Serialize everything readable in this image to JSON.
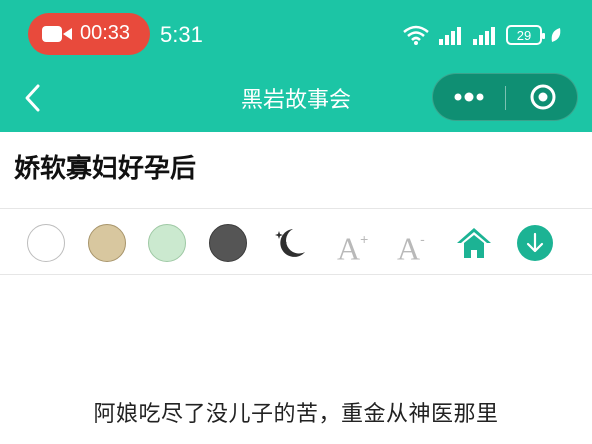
{
  "status_bar": {
    "record_time": "00:33",
    "clock": "5:31",
    "battery": "29",
    "colors": {
      "background": "#1cc5a5",
      "record_pill": "#e84a3c"
    }
  },
  "nav": {
    "title": "黑岩故事会",
    "icons": {
      "back": "chevron-left-icon",
      "more": "more-dots-icon",
      "close": "target-circle-icon"
    }
  },
  "article": {
    "title": "娇软寡妇好孕后",
    "first_line": "阿娘吃尽了没儿子的苦，重金从神医那里"
  },
  "toolbar": {
    "swatches": [
      {
        "name": "white",
        "color": "#ffffff"
      },
      {
        "name": "tan",
        "color": "#d8c79f"
      },
      {
        "name": "mint",
        "color": "#cbe9cf"
      },
      {
        "name": "dark-gray",
        "color": "#555555"
      }
    ],
    "font_up": {
      "letter": "A",
      "sign": "+"
    },
    "font_down": {
      "letter": "A",
      "sign": "-"
    },
    "accent": "#1cb394"
  }
}
